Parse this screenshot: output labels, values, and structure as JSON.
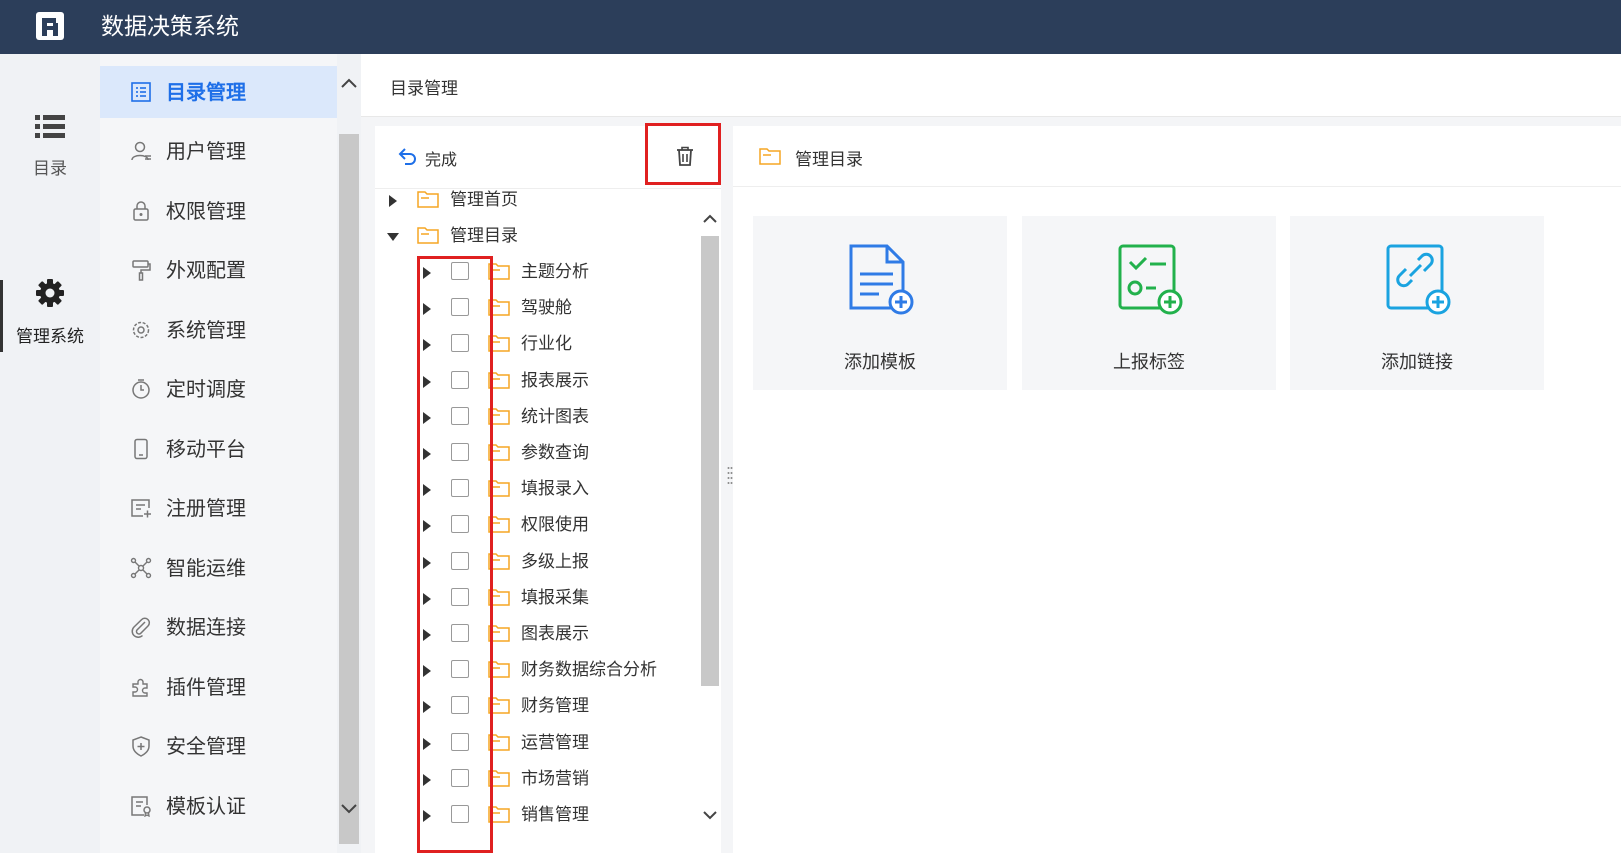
{
  "app": {
    "title": "数据决策系统"
  },
  "rail": {
    "catalog_label": "目录",
    "manage_label": "管理系统"
  },
  "menu": {
    "items": [
      {
        "label": "目录管理",
        "icon": "list-icon",
        "active": true
      },
      {
        "label": "用户管理",
        "icon": "user-icon"
      },
      {
        "label": "权限管理",
        "icon": "lock-icon"
      },
      {
        "label": "外观配置",
        "icon": "paint-roller-icon"
      },
      {
        "label": "系统管理",
        "icon": "gear-icon"
      },
      {
        "label": "定时调度",
        "icon": "timer-icon"
      },
      {
        "label": "移动平台",
        "icon": "mobile-icon"
      },
      {
        "label": "注册管理",
        "icon": "register-icon"
      },
      {
        "label": "智能运维",
        "icon": "network-icon"
      },
      {
        "label": "数据连接",
        "icon": "paperclip-icon"
      },
      {
        "label": "插件管理",
        "icon": "puzzle-icon"
      },
      {
        "label": "安全管理",
        "icon": "shield-icon"
      },
      {
        "label": "模板认证",
        "icon": "certificate-icon"
      }
    ]
  },
  "main": {
    "breadcrumb": "目录管理"
  },
  "tree": {
    "done_label": "完成",
    "roots": [
      {
        "label": "管理首页",
        "expanded": false
      },
      {
        "label": "管理目录",
        "expanded": true
      }
    ],
    "children": [
      "主题分析",
      "驾驶舱",
      "行业化",
      "报表展示",
      "统计图表",
      "参数查询",
      "填报录入",
      "权限使用",
      "多级上报",
      "填报采集",
      "图表展示",
      "财务数据综合分析",
      "财务管理",
      "运营管理",
      "市场营销",
      "销售管理"
    ]
  },
  "right": {
    "title": "管理目录",
    "cards": [
      {
        "label": "添加模板",
        "icon": "add-template-icon",
        "color": "#2f7be6"
      },
      {
        "label": "上报标签",
        "icon": "report-tag-icon",
        "color": "#22b14c"
      },
      {
        "label": "添加链接",
        "icon": "add-link-icon",
        "color": "#1aa3e0"
      }
    ]
  },
  "colors": {
    "header_bg": "#2c3e5a",
    "accent": "#1e6fe8",
    "highlight": "#e02020",
    "folder": "#f5a623"
  }
}
